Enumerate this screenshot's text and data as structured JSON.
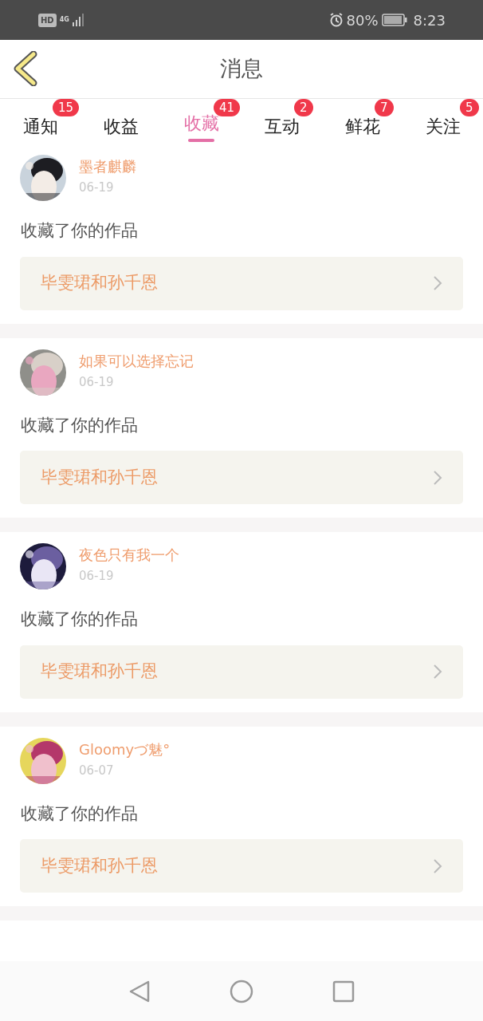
{
  "status_bar": {
    "hd": "HD",
    "network": "4G",
    "battery_percent": "80%",
    "time": "8:23"
  },
  "header": {
    "title": "消息"
  },
  "tabs": [
    {
      "label": "通知",
      "badge": "15",
      "selected": false
    },
    {
      "label": "收益",
      "selected": false
    },
    {
      "label": "收藏",
      "badge": "41",
      "selected": true
    },
    {
      "label": "互动",
      "badge": "2",
      "selected": false
    },
    {
      "label": "鲜花",
      "badge": "7",
      "selected": false
    },
    {
      "label": "关注",
      "badge": "5",
      "selected": false
    }
  ],
  "messages": [
    {
      "user": "墨者麒麟",
      "date": "06-19",
      "action": "收藏了你的作品",
      "work": "毕雯珺和孙千恩"
    },
    {
      "user": "如果可以选择忘记",
      "date": "06-19",
      "action": "收藏了你的作品",
      "work": "毕雯珺和孙千恩"
    },
    {
      "user": "夜色只有我一个",
      "date": "06-19",
      "action": "收藏了你的作品",
      "work": "毕雯珺和孙千恩"
    },
    {
      "user": "Gloomyづ魅°",
      "date": "06-07",
      "action": "收藏了你的作品",
      "work": "毕雯珺和孙千恩"
    }
  ]
}
